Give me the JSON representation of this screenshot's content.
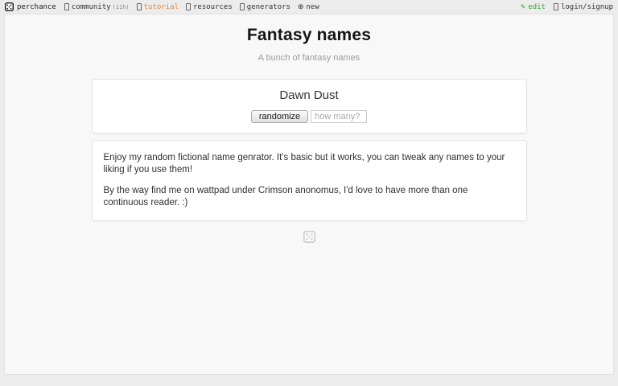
{
  "navbar": {
    "brand": "perchance",
    "community_label": "community",
    "community_suffix": "(11h)",
    "tutorial_label": "tutorial",
    "resources_label": "resources",
    "generators_label": "generators",
    "new_icon": "⊕",
    "new_label": "new",
    "edit_icon": "✎",
    "edit_label": "edit",
    "login_label": "login/signup"
  },
  "header": {
    "title": "Fantasy names",
    "subtitle": "A bunch of fantasy names"
  },
  "generator": {
    "result": "Dawn Dust",
    "randomize_label": "randomize",
    "how_many_placeholder": "how many?"
  },
  "description": {
    "line1": "Enjoy my random fictional name genrator. It's basic but it works, you can tweak any names to your liking if you use them!",
    "line2": "By the way find me on wattpad under Crimson anonomus, I'd love to have more than one continuous reader. :)"
  },
  "colors": {
    "tutorial_orange": "#e8833a",
    "edit_green": "#2fa233",
    "page_bg": "#ececec",
    "card_bg": "#f8f8f8",
    "watermark_gray": "#c2c2c2"
  }
}
